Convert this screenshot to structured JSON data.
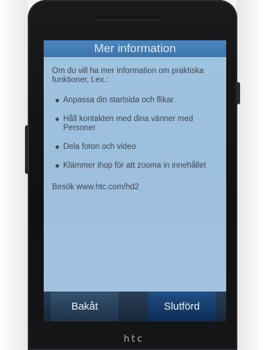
{
  "device": {
    "brand_logo": "htc"
  },
  "screen": {
    "title": "Mer information",
    "intro": "Om du vill ha mer information om praktiska funktioner, t.ex.:",
    "items": [
      "Anpassa din startsida och flikar",
      "Håll kontakten med dina vänner med Personer",
      "Dela foton och video",
      "Klämmer ihop för att zooma in innehållet"
    ],
    "visit": "Besök www.htc.com/hd2",
    "back_label": "Bakåt",
    "done_label": "Slutförd"
  },
  "colors": {
    "screen_background": "#9ec2e0",
    "title_bar": "#4a86bf",
    "button_bar": "#1e3249"
  }
}
